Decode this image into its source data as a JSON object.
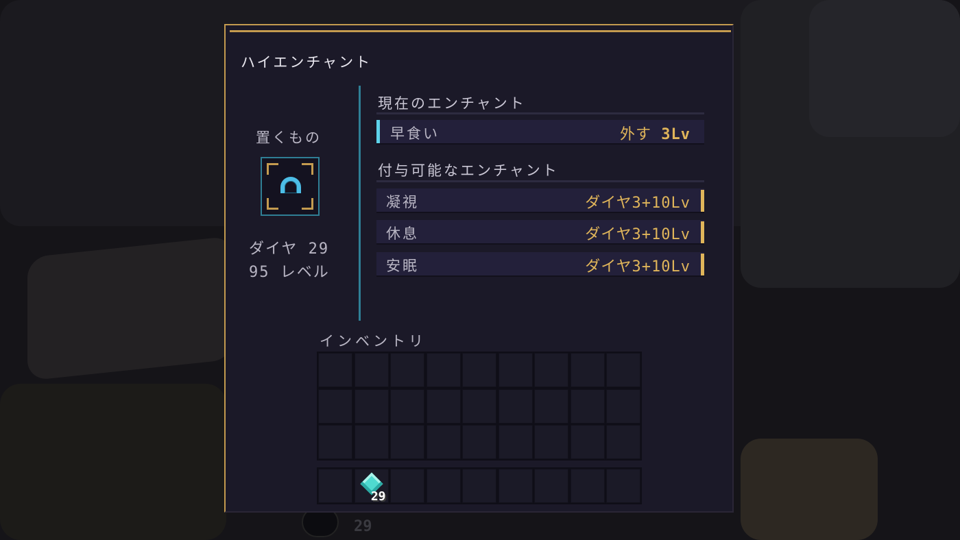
{
  "panel": {
    "title": "ハイエンチャント",
    "accent_color": "#c49b4f"
  },
  "item": {
    "label": "置くもの",
    "icon": "diamond-helmet-icon",
    "diamond_count": "ダイヤ 29",
    "level": "95 レベル"
  },
  "current": {
    "header": "現在のエンチャント",
    "rows": [
      {
        "name": "早食い",
        "action": "外す",
        "cost": "3Lv"
      }
    ]
  },
  "available": {
    "header": "付与可能なエンチャント",
    "rows": [
      {
        "name": "凝視",
        "cost": "ダイヤ3+10Lv"
      },
      {
        "name": "休息",
        "cost": "ダイヤ3+10Lv"
      },
      {
        "name": "安眠",
        "cost": "ダイヤ3+10Lv"
      }
    ]
  },
  "inventory": {
    "label": "インベントリ",
    "hotbar_item": {
      "icon": "diamond-icon",
      "count": "29"
    }
  },
  "background": {
    "ghost_count": "29"
  }
}
